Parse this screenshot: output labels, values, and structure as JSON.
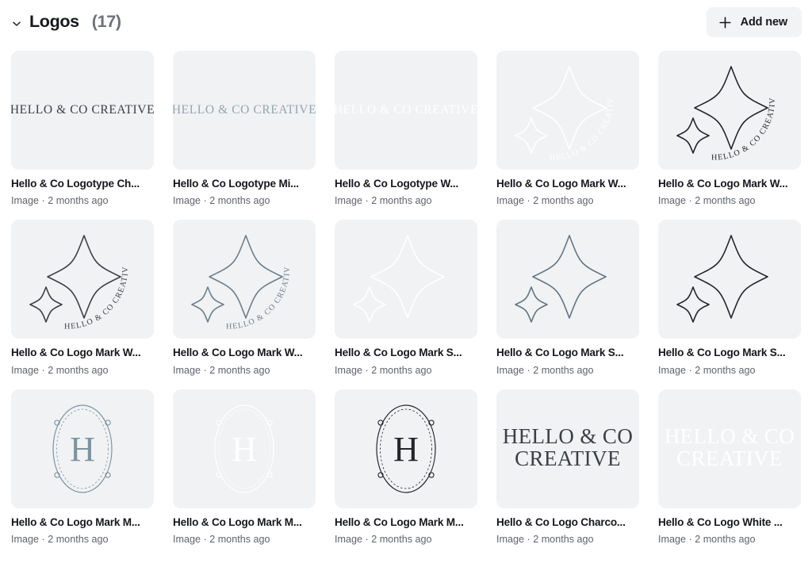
{
  "header": {
    "title": "Logos",
    "count": "(17)",
    "collapse_icon": "chevron-down-icon",
    "add_new": {
      "label": "Add new",
      "icon": "plus-icon"
    }
  },
  "colors": {
    "page_background": "#ffffff",
    "tile_background": "#f1f2f4",
    "button_background": "#f2f3f5",
    "title_text": "#16181d",
    "meta_text": "#5f636b",
    "count_text": "#6d7178",
    "art_charcoal": "#3b4046",
    "art_dark": "#23262b",
    "art_muted_blue": "#6b7f8c",
    "art_light_blue": "#9fb3bd",
    "art_white": "#ffffff"
  },
  "brand_text": {
    "wordmark": "HELLO & CO CREATIVE",
    "wordmark_line1": "HELLO & CO",
    "wordmark_line2": "CREATIVE",
    "monogram": "H",
    "arc_text": "HELLO & CO CREATIVE"
  },
  "grid": {
    "columns": 5,
    "items": [
      {
        "title": "Hello & Co Logotype Ch...",
        "meta": "Image · 2 months ago",
        "art": "wordmark-inline",
        "color": "#3b4046"
      },
      {
        "title": "Hello & Co Logotype Mi...",
        "meta": "Image · 2 months ago",
        "art": "wordmark-inline",
        "color": "#93a6b1"
      },
      {
        "title": "Hello & Co Logotype W...",
        "meta": "Image · 2 months ago",
        "art": "wordmark-inline",
        "color": "#ffffff"
      },
      {
        "title": "Hello & Co Logo Mark W...",
        "meta": "Image · 2 months ago",
        "art": "stars-with-arc-text",
        "color": "#ffffff"
      },
      {
        "title": "Hello & Co Logo Mark W...",
        "meta": "Image · 2 months ago",
        "art": "stars-with-arc-text",
        "color": "#23262b"
      },
      {
        "title": "Hello & Co Logo Mark W...",
        "meta": "Image · 2 months ago",
        "art": "stars-with-arc-text",
        "color": "#3b4046"
      },
      {
        "title": "Hello & Co Logo Mark W...",
        "meta": "Image · 2 months ago",
        "art": "stars-with-arc-text",
        "color": "#6b7f8c"
      },
      {
        "title": "Hello & Co Logo Mark S...",
        "meta": "Image · 2 months ago",
        "art": "stars-only",
        "color": "#ffffff"
      },
      {
        "title": "Hello & Co Logo Mark S...",
        "meta": "Image · 2 months ago",
        "art": "stars-only",
        "color": "#5f7682"
      },
      {
        "title": "Hello & Co Logo Mark S...",
        "meta": "Image · 2 months ago",
        "art": "stars-only",
        "color": "#23262b"
      },
      {
        "title": "Hello & Co Logo Mark M...",
        "meta": "Image · 2 months ago",
        "art": "monogram-frame",
        "color": "#7d93a0"
      },
      {
        "title": "Hello & Co Logo Mark M...",
        "meta": "Image · 2 months ago",
        "art": "monogram-frame",
        "color": "#ffffff"
      },
      {
        "title": "Hello & Co Logo Mark M...",
        "meta": "Image · 2 months ago",
        "art": "monogram-frame",
        "color": "#23262b"
      },
      {
        "title": "Hello & Co Logo Charco...",
        "meta": "Image · 2 months ago",
        "art": "wordmark-stacked",
        "color": "#3b4046"
      },
      {
        "title": "Hello & Co Logo White ...",
        "meta": "Image · 2 months ago",
        "art": "wordmark-stacked",
        "color": "#ffffff"
      }
    ]
  }
}
